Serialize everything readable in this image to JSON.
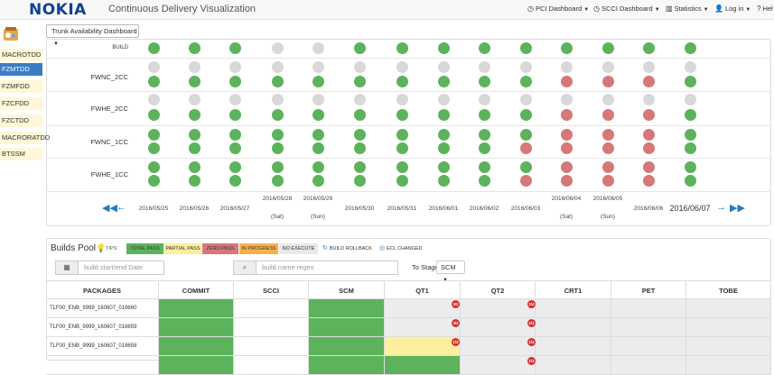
{
  "navbar": {
    "brand": "NOKIA",
    "subtitle": "Continuous Delivery Visualization",
    "items": [
      {
        "label": "PCI Dashboard",
        "icon": "clock-icon"
      },
      {
        "label": "SCCI Dashboard",
        "icon": "clock-icon"
      },
      {
        "label": "Statistics",
        "icon": "bar-chart-icon"
      },
      {
        "label": "Log in",
        "icon": "user-icon"
      },
      {
        "label": "Hel",
        "icon": "help-icon"
      }
    ]
  },
  "sidebar": {
    "items": [
      "MACROTDD",
      "FZMTDD",
      "FZMFDD",
      "FZCFDD",
      "FZCTDD",
      "MACRORATDD",
      "BTSSM"
    ],
    "active": "FZMTDD"
  },
  "dashboard": {
    "selector": "Trunk Availability Dashboard",
    "rows": [
      {
        "label": "BUILD",
        "dots": [
          [
            "g"
          ],
          [
            "g"
          ],
          [
            "g"
          ],
          [
            "gr"
          ],
          [
            "gr"
          ],
          [
            "g"
          ],
          [
            "g"
          ],
          [
            "g"
          ],
          [
            "g"
          ],
          [
            "g"
          ],
          [
            "g"
          ],
          [
            "g"
          ],
          [
            "g"
          ],
          [
            "g"
          ]
        ]
      },
      {
        "label": "FWNC_2CC",
        "dots": [
          [
            "gr",
            "g"
          ],
          [
            "gr",
            "g"
          ],
          [
            "gr",
            "g"
          ],
          [
            "gr",
            "g"
          ],
          [
            "gr",
            "g"
          ],
          [
            "gr",
            "g"
          ],
          [
            "gr",
            "g"
          ],
          [
            "gr",
            "g"
          ],
          [
            "gr",
            "g"
          ],
          [
            "gr",
            "g"
          ],
          [
            "gr",
            "r"
          ],
          [
            "gr",
            "r"
          ],
          [
            "gr",
            "r"
          ],
          [
            "gr",
            "g"
          ]
        ]
      },
      {
        "label": "FWHE_2CC",
        "dots": [
          [
            "gr",
            "g"
          ],
          [
            "gr",
            "g"
          ],
          [
            "gr",
            "g"
          ],
          [
            "gr",
            "g"
          ],
          [
            "gr",
            "g"
          ],
          [
            "gr",
            "g"
          ],
          [
            "gr",
            "g"
          ],
          [
            "gr",
            "g"
          ],
          [
            "gr",
            "g"
          ],
          [
            "gr",
            "g"
          ],
          [
            "gr",
            "r"
          ],
          [
            "gr",
            "r"
          ],
          [
            "gr",
            "r"
          ],
          [
            "gr",
            "g"
          ]
        ]
      },
      {
        "label": "FWNC_1CC",
        "dots": [
          [
            "g",
            "g"
          ],
          [
            "g",
            "g"
          ],
          [
            "g",
            "g"
          ],
          [
            "g",
            "g"
          ],
          [
            "g",
            "g"
          ],
          [
            "g",
            "g"
          ],
          [
            "g",
            "g"
          ],
          [
            "g",
            "g"
          ],
          [
            "g",
            "g"
          ],
          [
            "g",
            "r"
          ],
          [
            "r",
            "r"
          ],
          [
            "r",
            "r"
          ],
          [
            "r",
            "r"
          ],
          [
            "g",
            "g"
          ]
        ]
      },
      {
        "label": "FWHE_1CC",
        "dots": [
          [
            "g",
            "g"
          ],
          [
            "g",
            "g"
          ],
          [
            "g",
            "g"
          ],
          [
            "g",
            "g"
          ],
          [
            "g",
            "g"
          ],
          [
            "g",
            "g"
          ],
          [
            "g",
            "g"
          ],
          [
            "g",
            "g"
          ],
          [
            "g",
            "g"
          ],
          [
            "g",
            "r"
          ],
          [
            "r",
            "r"
          ],
          [
            "r",
            "r"
          ],
          [
            "r",
            "r"
          ],
          [
            "g",
            "g"
          ]
        ]
      }
    ],
    "dates": [
      {
        "date": "2016/05/25",
        "sub": ""
      },
      {
        "date": "2016/05/26",
        "sub": ""
      },
      {
        "date": "2016/05/27",
        "sub": ""
      },
      {
        "date": "2016/05/28",
        "sub": "(Sat)"
      },
      {
        "date": "2016/05/29",
        "sub": "(Sun)"
      },
      {
        "date": "2016/05/30",
        "sub": ""
      },
      {
        "date": "2016/05/31",
        "sub": ""
      },
      {
        "date": "2016/06/01",
        "sub": ""
      },
      {
        "date": "2016/06/02",
        "sub": ""
      },
      {
        "date": "2016/06/03",
        "sub": ""
      },
      {
        "date": "2016/06/04",
        "sub": "(Sat)"
      },
      {
        "date": "2016/06/05",
        "sub": "(Sun)"
      },
      {
        "date": "2016/06/06",
        "sub": ""
      },
      {
        "date": "2016/06/07",
        "sub": ""
      }
    ]
  },
  "pool": {
    "title": "Builds Pool",
    "tips": "TIPS:",
    "legend": [
      "TOTAL PASS",
      "PARTIAL PASS",
      "ZERO PASS",
      "IN PROGRESS",
      "NO EXECUTE"
    ],
    "legend_icons": [
      "BUILD ROLLBACK",
      "ECL CHANGED"
    ],
    "date_placeholder": "build start/end Date",
    "name_placeholder": "build name regex",
    "stage_label": "To Stage",
    "stage_value": "SCM",
    "columns": [
      "PACKAGES",
      "COMMIT",
      "SCCI",
      "SCM",
      "QT1",
      "QT2",
      "CRT1",
      "PET",
      "TOBE"
    ],
    "rows": [
      {
        "package": "TLF00_ENB_9999_160607_018660",
        "cells": [
          "green",
          "white",
          "green",
          "lgray",
          "lgray",
          "lgray",
          "lgray",
          "lgray"
        ],
        "qt1_badge": "3/2",
        "qt2_badge": "2/4"
      },
      {
        "package": "TLF00_ENB_9999_160607_018659",
        "cells": [
          "green",
          "white",
          "green",
          "lgray",
          "lgray",
          "lgray",
          "lgray",
          "lgray"
        ],
        "qt1_badge": "3/2",
        "qt2_badge": "2/4"
      },
      {
        "package": "TLF00_ENB_9999_160607_018658",
        "cells": [
          "green",
          "white",
          "green",
          "yellow",
          "lgray",
          "lgray",
          "lgray",
          "lgray"
        ],
        "qt1_badge": "1/2",
        "qt2_badge": "2/4"
      },
      {
        "package": "",
        "cells": [
          "green",
          "white",
          "green",
          "green",
          "lgray",
          "lgray",
          "lgray",
          "lgray"
        ],
        "qt1_badge": "",
        "qt2_badge": "2/4"
      }
    ]
  },
  "colors": {
    "pass": "#5cb35c",
    "fail": "#d67878",
    "none": "#d8d8d8",
    "partial": "#fcef9e",
    "progress": "#f5b24b",
    "active_side": "#3b7dc4",
    "brand": "#124191"
  }
}
